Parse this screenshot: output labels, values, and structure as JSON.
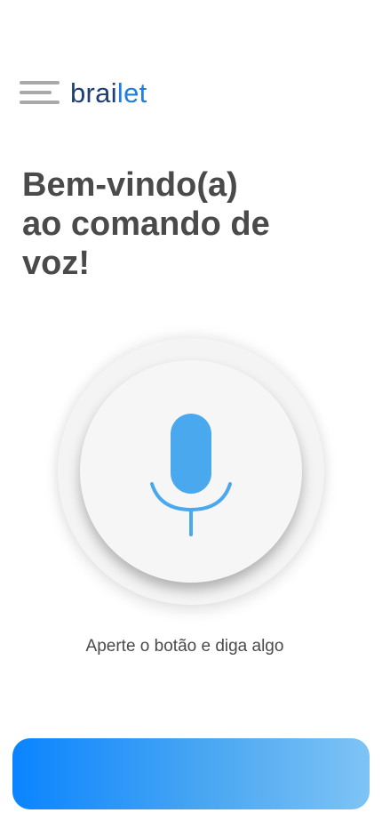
{
  "header": {
    "menu_icon": "hamburger-menu-icon",
    "brand_part1": "brai",
    "brand_part2": "let"
  },
  "welcome": {
    "line1": "Bem-vindo(a)",
    "line2": "ao comando de",
    "line3": "voz!"
  },
  "mic": {
    "icon": "microphone-icon",
    "accent_color": "#4aa8ee"
  },
  "hint": "Aperte o botão e diga algo",
  "colors": {
    "brand_dark": "#1d3f73",
    "brand_accent": "#1f7fe0",
    "heading": "#4a4a4a",
    "button_gradient_start": "#0a84ff",
    "button_gradient_end": "#7ec3f5"
  }
}
